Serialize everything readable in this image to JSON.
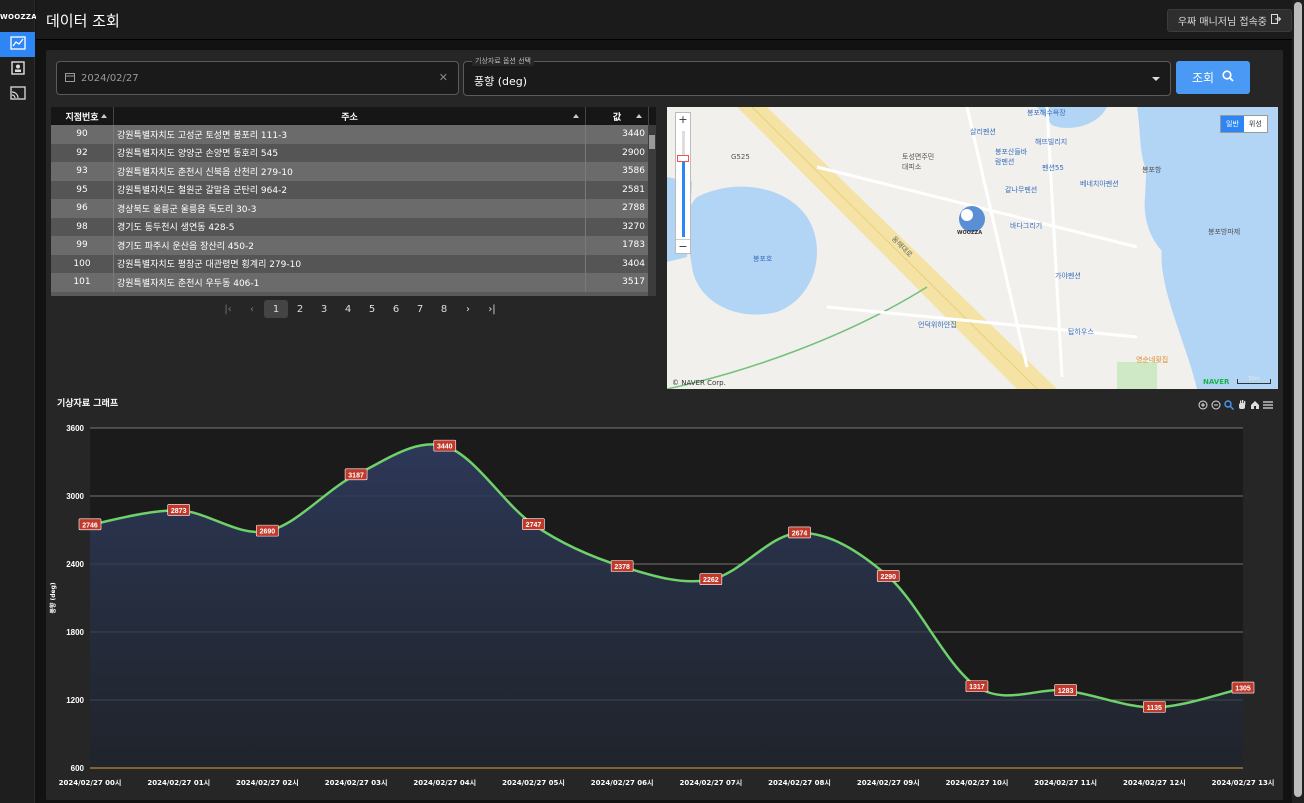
{
  "app": {
    "logo": "WOOZZA",
    "title": "데이터 조회",
    "user_button": "우짜 매니저님 접속중"
  },
  "sidebar": {
    "items": [
      {
        "icon": "chart-icon",
        "active": true
      },
      {
        "icon": "contact-icon"
      },
      {
        "icon": "cast-icon"
      }
    ]
  },
  "filters": {
    "date_value": "2024/02/27",
    "option_legend": "기상자료 옵션 선택",
    "option_value": "풍향 (deg)",
    "search_label": "조회"
  },
  "table": {
    "headers": [
      "지점번호",
      "주소",
      "값"
    ],
    "rows": [
      [
        "90",
        "강원특별자치도 고성군 토성면 봉포리 111-3",
        "3440"
      ],
      [
        "92",
        "강원특별자치도 양양군 손양면 동호리 545",
        "2900"
      ],
      [
        "93",
        "강원특별자치도 춘천시 신북읍 산천리 279-10",
        "3586"
      ],
      [
        "95",
        "강원특별자치도 철원군 갈말읍 군탄리 964-2",
        "2581"
      ],
      [
        "96",
        "경상북도 울릉군 울릉읍 독도리 30-3",
        "2788"
      ],
      [
        "98",
        "경기도 동두천시 생연동 428-5",
        "3270"
      ],
      [
        "99",
        "경기도 파주시 운산읍 장산리 450-2",
        "1783"
      ],
      [
        "100",
        "강원특별자치도 평창군 대관령면 횡계리 279-10",
        "3404"
      ],
      [
        "101",
        "강원특별자치도 춘천시 우두동 406-1",
        "3517"
      ]
    ]
  },
  "pagination": {
    "pages": [
      "1",
      "2",
      "3",
      "4",
      "5",
      "6",
      "7",
      "8"
    ],
    "current": "1"
  },
  "map": {
    "mode_normal": "일반",
    "mode_satellite": "위성",
    "copyright": "© NAVER Corp.",
    "brand": "NAVER",
    "scale": "50m",
    "labels": {
      "bongpo_beach": "봉포해수욕장",
      "sari": "살리펜션",
      "herbville": "해뜨빌리지",
      "bongpo_dream": "봉포산들바람펜션",
      "tosung": "토성면주민대피소",
      "g525": "G525",
      "pension55": "펜션55",
      "ganaru": "갈나무펜션",
      "venetia": "베네치아펜션",
      "bongpo_port": "봉포항",
      "breakwater": "봉포방파제",
      "bada": "바다그리기",
      "gaya": "가야펜션",
      "bongpo_lake": "봉포호",
      "road": "동해대로",
      "hill": "언덕위하얀집",
      "tap": "탑하우스",
      "youngsun": "영순네횟집",
      "woozza_marker": "WOOZZA"
    }
  },
  "chart_title": "기상자료 그래프",
  "chart_data": {
    "type": "area",
    "title": "기상자료 그래프",
    "ylabel": "풍향 (deg)",
    "ylim": [
      600,
      3600
    ],
    "yticks": [
      600,
      1200,
      1800,
      2400,
      3000,
      3600
    ],
    "categories": [
      "2024/02/27 00시",
      "2024/02/27 01시",
      "2024/02/27 02시",
      "2024/02/27 03시",
      "2024/02/27 04시",
      "2024/02/27 05시",
      "2024/02/27 06시",
      "2024/02/27 07시",
      "2024/02/27 08시",
      "2024/02/27 09시",
      "2024/02/27 10시",
      "2024/02/27 11시",
      "2024/02/27 12시",
      "2024/02/27 13시"
    ],
    "values": [
      2746,
      2873,
      2690,
      3187,
      3440,
      2747,
      2378,
      2262,
      2674,
      2290,
      1317,
      1283,
      1135,
      1305
    ],
    "line_color": "#6fd16a",
    "label_color": "#c0392b"
  }
}
